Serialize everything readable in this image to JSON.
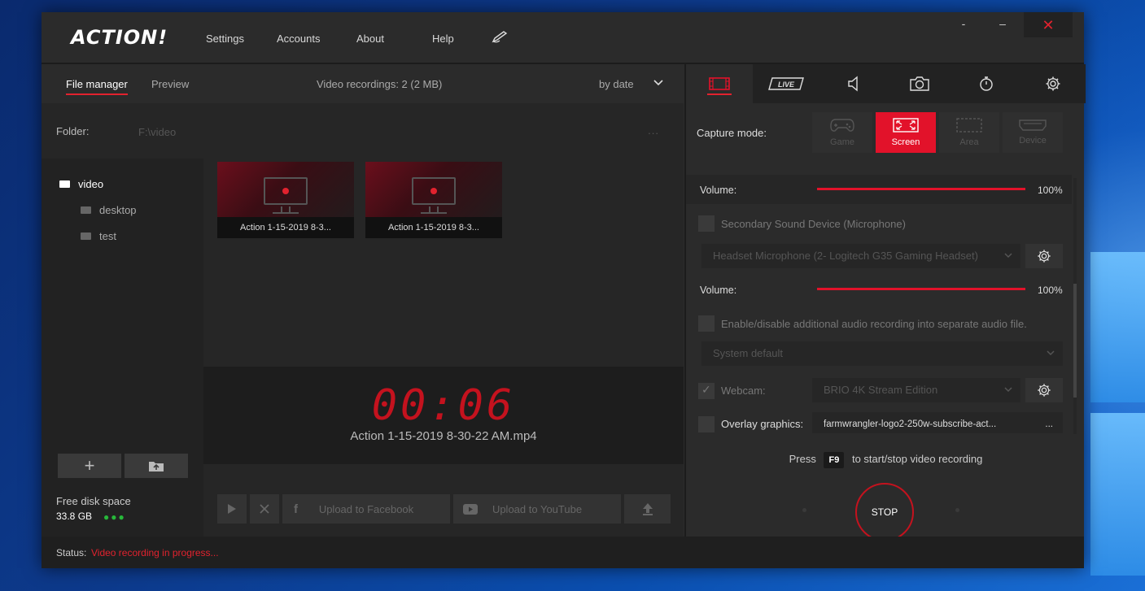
{
  "app": {
    "logo": "ACTION!",
    "menu": [
      "Settings",
      "Accounts",
      "About",
      "Help"
    ],
    "window_controls": {
      "minimize": "-",
      "maximize": "–",
      "close": "✕"
    }
  },
  "left": {
    "tabs": [
      "File manager",
      "Preview"
    ],
    "recordings_info": "Video recordings: 2 (2 MB)",
    "sort": "by date",
    "folder_label": "Folder:",
    "folder_path": "F:\\video",
    "folder_browse": "...",
    "tree": {
      "root": "video",
      "children": [
        "desktop",
        "test"
      ]
    },
    "tree_add": "+",
    "disk": {
      "label": "Free disk space",
      "value": "33.8 GB",
      "dots": "●●●"
    },
    "thumbnails": [
      {
        "caption": "Action 1-15-2019 8-3..."
      },
      {
        "caption": "Action 1-15-2019 8-3..."
      }
    ],
    "timer": "00:06",
    "timer_file": "Action 1-15-2019 8-30-22 AM.mp4",
    "upload_facebook": "Upload to Facebook",
    "upload_youtube": "Upload to YouTube"
  },
  "right": {
    "capture_label": "Capture mode:",
    "modes": [
      "Game",
      "Screen",
      "Area",
      "Device"
    ],
    "live_label": "LIVE",
    "volume_label": "Volume:",
    "volume1": "100%",
    "secondary_label": "Secondary Sound Device (Microphone)",
    "mic_device": "Headset Microphone (2- Logitech G35 Gaming Headset)",
    "volume2": "100%",
    "separate_audio_label": "Enable/disable additional audio recording into separate audio file.",
    "system_default": "System default",
    "webcam_label": "Webcam:",
    "webcam_device": "BRIO 4K Stream Edition",
    "overlay_label": "Overlay graphics:",
    "overlay_file": "farmwrangler-logo2-250w-subscribe-act...",
    "overlay_browse": "...",
    "hotkey_pre": "Press",
    "hotkey_key": "F9",
    "hotkey_post": "to start/stop video recording",
    "stop": "STOP"
  },
  "status": {
    "label": "Status:",
    "value": "Video recording in progress..."
  },
  "colors": {
    "accent": "#e2122a",
    "timer": "#c4121e",
    "bg": "#2b2b2b"
  }
}
